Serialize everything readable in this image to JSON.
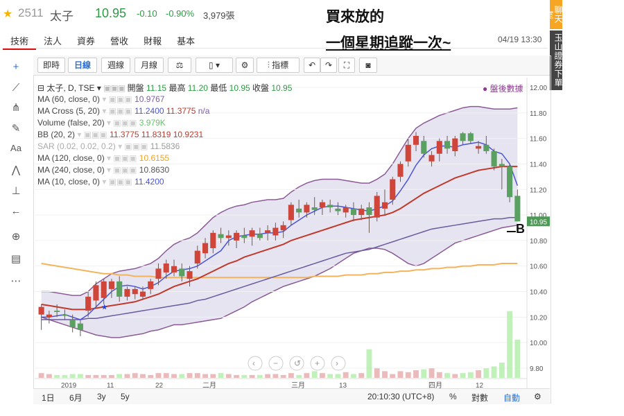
{
  "header": {
    "code": "2511",
    "name": "太子",
    "price": "10.95",
    "change": "-0.10",
    "change_pct": "-0.90%",
    "volume": "3,979張",
    "tabs": [
      "技術",
      "法人",
      "資券",
      "營收",
      "財報",
      "基本"
    ],
    "datetime": "04/19 13:30"
  },
  "notes": {
    "line1": "買來放的",
    "line2": "一個星期追蹤一次~"
  },
  "side": {
    "chat": "聊天室",
    "broker": "玉山證券下單"
  },
  "toolbar": {
    "intraday": "即時",
    "daily": "日線",
    "weekly": "週線",
    "monthly": "月線",
    "indicators": "指標"
  },
  "legend": {
    "symbol": "太子, D, TSE",
    "ohlc_labels": [
      "開盤",
      "最高",
      "最低",
      "收盤"
    ],
    "ohlc_values": [
      "11.15",
      "11.20",
      "10.95",
      "10.95"
    ],
    "after_hours": "盤後數據",
    "rows": [
      {
        "label": "MA (60, close, 0)",
        "values": [
          "10.9767"
        ],
        "colors": [
          "#7b5ea7"
        ]
      },
      {
        "label": "MA Cross (5, 20)",
        "values": [
          "11.2400",
          "11.3775",
          "n/a"
        ],
        "colors": [
          "#4a54d6",
          "#c0392b",
          "#7b5ea7"
        ]
      },
      {
        "label": "Volume (false, 20)",
        "values": [
          "3.979K"
        ],
        "colors": [
          "#67c26b"
        ]
      },
      {
        "label": "BB (20, 2)",
        "values": [
          "11.3775",
          "11.8319",
          "10.9231"
        ],
        "colors": [
          "#c0392b",
          "#c0392b",
          "#c0392b"
        ]
      },
      {
        "label": "SAR (0.02, 0.02, 0.2)",
        "values": [
          "11.5836"
        ],
        "colors": [
          "#9a9a9a"
        ]
      },
      {
        "label": "MA (120, close, 0)",
        "values": [
          "10.6155"
        ],
        "colors": [
          "#f0a020"
        ]
      },
      {
        "label": "MA (240, close, 0)",
        "values": [
          "10.8630"
        ],
        "colors": [
          "#555"
        ]
      },
      {
        "label": "MA (10, close, 0)",
        "values": [
          "11.4200"
        ],
        "colors": [
          "#4a54d6"
        ]
      }
    ]
  },
  "annotations": {
    "b_mark": "B",
    "last_price_tag": "10.95"
  },
  "bottom": {
    "ranges": [
      "1日",
      "6月",
      "3y",
      "5y"
    ],
    "clock": "20:10:30 (UTC+8)",
    "pct": "%",
    "log": "對數",
    "auto": "自動"
  },
  "chart_data": {
    "type": "candlestick",
    "y_ticks": [
      "12.00",
      "11.80",
      "11.60",
      "11.40",
      "11.20",
      "11.00",
      "10.80",
      "10.60",
      "10.40",
      "10.20",
      "10.00",
      "9.80"
    ],
    "ylim": [
      9.8,
      12.0
    ],
    "x_ticks": [
      "2019",
      "11",
      "22",
      "二月",
      "三月",
      "13",
      "四月",
      "12"
    ],
    "candles": [
      [
        10.22,
        10.3,
        10.1,
        10.28
      ],
      [
        10.2,
        10.25,
        10.15,
        10.22
      ],
      [
        10.25,
        10.3,
        10.2,
        10.24
      ],
      [
        10.22,
        10.26,
        10.18,
        10.21
      ],
      [
        10.18,
        10.22,
        10.08,
        10.12
      ],
      [
        10.15,
        10.18,
        10.05,
        10.1
      ],
      [
        10.25,
        10.4,
        10.2,
        10.36
      ],
      [
        10.33,
        10.48,
        10.28,
        10.45
      ],
      [
        10.35,
        10.5,
        10.3,
        10.48
      ],
      [
        10.42,
        10.5,
        10.35,
        10.48
      ],
      [
        10.48,
        10.52,
        10.32,
        10.36
      ],
      [
        10.36,
        10.44,
        10.33,
        10.42
      ],
      [
        10.38,
        10.44,
        10.34,
        10.42
      ],
      [
        10.36,
        10.44,
        10.34,
        10.4
      ],
      [
        10.42,
        10.5,
        10.38,
        10.48
      ],
      [
        10.5,
        10.62,
        10.45,
        10.58
      ],
      [
        10.55,
        10.65,
        10.5,
        10.62
      ],
      [
        10.55,
        10.65,
        10.52,
        10.6
      ],
      [
        10.58,
        10.62,
        10.48,
        10.52
      ],
      [
        10.5,
        10.6,
        10.44,
        10.56
      ],
      [
        10.62,
        10.76,
        10.58,
        10.72
      ],
      [
        10.7,
        10.82,
        10.66,
        10.78
      ],
      [
        10.74,
        10.88,
        10.7,
        10.86
      ],
      [
        10.85,
        10.9,
        10.78,
        10.82
      ],
      [
        10.82,
        10.88,
        10.76,
        10.84
      ],
      [
        10.8,
        10.88,
        10.74,
        10.86
      ],
      [
        10.84,
        10.9,
        10.78,
        10.82
      ],
      [
        10.83,
        10.9,
        10.76,
        10.88
      ],
      [
        10.85,
        10.9,
        10.8,
        10.82
      ],
      [
        10.86,
        10.92,
        10.8,
        10.88
      ],
      [
        10.84,
        10.94,
        10.8,
        10.9
      ],
      [
        10.88,
        10.95,
        10.82,
        10.92
      ],
      [
        10.96,
        11.1,
        10.92,
        11.08
      ],
      [
        11.05,
        11.12,
        10.98,
        11.02
      ],
      [
        11.02,
        11.1,
        10.98,
        11.08
      ],
      [
        11.06,
        11.14,
        11.0,
        11.04
      ],
      [
        11.06,
        11.12,
        11.0,
        11.1
      ],
      [
        11.08,
        11.12,
        11.02,
        11.06
      ],
      [
        11.05,
        11.1,
        11.0,
        11.03
      ],
      [
        11.02,
        11.08,
        10.98,
        11.06
      ],
      [
        11.05,
        11.1,
        10.95,
        11.0
      ],
      [
        11.0,
        11.08,
        10.96,
        11.05
      ],
      [
        11.06,
        11.1,
        10.86,
        11.0
      ],
      [
        10.98,
        11.18,
        10.95,
        11.15
      ],
      [
        11.05,
        11.2,
        11.0,
        11.1
      ],
      [
        11.12,
        11.3,
        11.08,
        11.28
      ],
      [
        11.3,
        11.42,
        11.26,
        11.4
      ],
      [
        11.42,
        11.6,
        11.38,
        11.55
      ],
      [
        11.55,
        11.65,
        11.5,
        11.62
      ],
      [
        11.58,
        11.62,
        11.45,
        11.48
      ],
      [
        11.42,
        11.5,
        11.38,
        11.47
      ],
      [
        11.48,
        11.6,
        11.42,
        11.58
      ],
      [
        11.58,
        11.62,
        11.48,
        11.52
      ],
      [
        11.5,
        11.62,
        11.46,
        11.6
      ],
      [
        11.64,
        11.65,
        11.55,
        11.58
      ],
      [
        11.64,
        11.65,
        11.56,
        11.58
      ],
      [
        11.52,
        11.58,
        11.48,
        11.54
      ],
      [
        11.55,
        11.62,
        11.48,
        11.5
      ],
      [
        11.5,
        11.52,
        11.35,
        11.38
      ],
      [
        11.4,
        11.44,
        11.2,
        11.38
      ],
      [
        11.38,
        11.4,
        11.1,
        11.14
      ],
      [
        11.15,
        11.2,
        10.95,
        10.95
      ]
    ],
    "volume": [
      0.5,
      0.4,
      0.3,
      0.3,
      0.4,
      0.4,
      0.3,
      0.3,
      0.3,
      0.3,
      0.4,
      0.4,
      0.5,
      0.4,
      0.3,
      0.5,
      0.5,
      0.4,
      0.4,
      0.5,
      0.5,
      0.4,
      0.4,
      0.5,
      0.4,
      0.3,
      0.3,
      0.3,
      0.3,
      0.4,
      0.4,
      0.3,
      0.5,
      0.3,
      0.5,
      0.7,
      0.5,
      0.4,
      0.4,
      0.6,
      0.4,
      0.5,
      3.0,
      1.0,
      0.7,
      0.4,
      0.7,
      0.6,
      0.8,
      0.9,
      1.0,
      0.6,
      0.5,
      0.4,
      0.5,
      0.6,
      0.8,
      1.0,
      1.2,
      1.6,
      7.0,
      4.0
    ],
    "ma5": [
      10.2,
      10.2,
      10.21,
      10.22,
      10.2,
      10.18,
      10.22,
      10.28,
      10.34,
      10.4,
      10.44,
      10.45,
      10.44,
      10.42,
      10.44,
      10.47,
      10.52,
      10.56,
      10.57,
      10.58,
      10.6,
      10.64,
      10.68,
      10.72,
      10.8,
      10.83,
      10.84,
      10.85,
      10.85,
      10.86,
      10.86,
      10.87,
      10.92,
      10.96,
      11.0,
      11.03,
      11.06,
      11.07,
      11.07,
      11.06,
      11.05,
      11.04,
      11.03,
      11.05,
      11.07,
      11.11,
      11.19,
      11.28,
      11.39,
      11.47,
      11.52,
      11.54,
      11.54,
      11.53,
      11.55,
      11.56,
      11.57,
      11.55,
      11.5,
      11.48,
      11.4,
      11.23
    ],
    "ma20": [
      10.3,
      10.29,
      10.28,
      10.27,
      10.26,
      10.26,
      10.26,
      10.27,
      10.28,
      10.29,
      10.3,
      10.31,
      10.32,
      10.34,
      10.36,
      10.38,
      10.41,
      10.44,
      10.46,
      10.48,
      10.5,
      10.53,
      10.56,
      10.59,
      10.62,
      10.64,
      10.67,
      10.69,
      10.71,
      10.73,
      10.75,
      10.77,
      10.8,
      10.82,
      10.84,
      10.86,
      10.88,
      10.9,
      10.92,
      10.94,
      10.96,
      10.97,
      10.98,
      10.99,
      11.0,
      11.02,
      11.05,
      11.09,
      11.13,
      11.17,
      11.2,
      11.23,
      11.26,
      11.29,
      11.31,
      11.33,
      11.35,
      11.36,
      11.37,
      11.38,
      11.38,
      11.38
    ],
    "ma60": [
      10.18,
      10.18,
      10.18,
      10.18,
      10.18,
      10.18,
      10.19,
      10.19,
      10.2,
      10.21,
      10.22,
      10.23,
      10.24,
      10.25,
      10.26,
      10.27,
      10.28,
      10.29,
      10.3,
      10.31,
      10.33,
      10.34,
      10.36,
      10.38,
      10.4,
      10.42,
      10.44,
      10.46,
      10.48,
      10.5,
      10.52,
      10.54,
      10.56,
      10.58,
      10.6,
      10.62,
      10.64,
      10.66,
      10.68,
      10.7,
      10.71,
      10.72,
      10.73,
      10.75,
      10.77,
      10.79,
      10.81,
      10.83,
      10.85,
      10.87,
      10.89,
      10.9,
      10.91,
      10.92,
      10.93,
      10.94,
      10.95,
      10.96,
      10.97,
      10.97,
      10.98,
      10.98
    ],
    "ma120": [
      10.62,
      10.61,
      10.6,
      10.59,
      10.58,
      10.57,
      10.56,
      10.55,
      10.54,
      10.54,
      10.53,
      10.53,
      10.52,
      10.52,
      10.52,
      10.51,
      10.51,
      10.51,
      10.51,
      10.51,
      10.51,
      10.51,
      10.51,
      10.51,
      10.51,
      10.51,
      10.51,
      10.51,
      10.51,
      10.51,
      10.51,
      10.51,
      10.51,
      10.51,
      10.51,
      10.52,
      10.52,
      10.52,
      10.52,
      10.53,
      10.53,
      10.53,
      10.54,
      10.54,
      10.55,
      10.55,
      10.56,
      10.56,
      10.57,
      10.57,
      10.58,
      10.58,
      10.59,
      10.59,
      10.6,
      10.6,
      10.61,
      10.61,
      10.61,
      10.62,
      10.62,
      10.62
    ],
    "bb_upper": [
      10.4,
      10.4,
      10.39,
      10.38,
      10.37,
      10.37,
      10.4,
      10.46,
      10.5,
      10.54,
      10.56,
      10.57,
      10.58,
      10.6,
      10.62,
      10.66,
      10.72,
      10.77,
      10.8,
      10.82,
      10.86,
      10.92,
      10.98,
      11.02,
      11.05,
      11.07,
      11.08,
      11.1,
      11.11,
      11.12,
      11.12,
      11.13,
      11.18,
      11.22,
      11.25,
      11.27,
      11.28,
      11.28,
      11.28,
      11.27,
      11.26,
      11.25,
      11.25,
      11.28,
      11.32,
      11.4,
      11.5,
      11.6,
      11.68,
      11.72,
      11.75,
      11.78,
      11.8,
      11.82,
      11.84,
      11.85,
      11.85,
      11.84,
      11.83,
      11.83,
      11.83,
      11.84
    ],
    "bb_lower": [
      10.2,
      10.18,
      10.16,
      10.14,
      10.12,
      10.1,
      10.08,
      10.06,
      10.05,
      10.04,
      10.04,
      10.05,
      10.06,
      10.07,
      10.09,
      10.1,
      10.12,
      10.14,
      10.14,
      10.15,
      10.16,
      10.17,
      10.18,
      10.19,
      10.22,
      10.25,
      10.28,
      10.32,
      10.35,
      10.38,
      10.41,
      10.44,
      10.46,
      10.48,
      10.5,
      10.52,
      10.55,
      10.58,
      10.62,
      10.66,
      10.7,
      10.72,
      10.74,
      10.74,
      10.73,
      10.7,
      10.66,
      10.62,
      10.6,
      10.62,
      10.66,
      10.7,
      10.74,
      10.78,
      10.8,
      10.82,
      10.84,
      10.86,
      10.88,
      10.9,
      10.91,
      10.92
    ],
    "sar_star": {
      "index": 8,
      "value": 10.28
    },
    "last_price": 10.95
  }
}
